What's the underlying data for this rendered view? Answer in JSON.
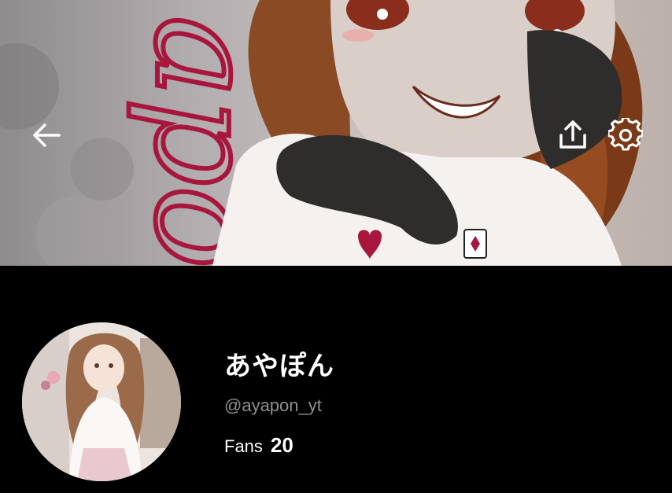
{
  "header": {
    "back_icon": "arrow-left-icon",
    "share_icon": "share-upload-icon",
    "settings_icon": "gear-icon",
    "cover_lettering": "apo"
  },
  "profile": {
    "display_name": "あやぽん",
    "handle": "@ayapon_yt",
    "fans_label": "Fans",
    "fans_count": "20"
  },
  "colors": {
    "background": "#000000",
    "text_primary": "#ffffff",
    "text_secondary": "#8e8e8e",
    "cover_lettering": "#a8163e"
  }
}
